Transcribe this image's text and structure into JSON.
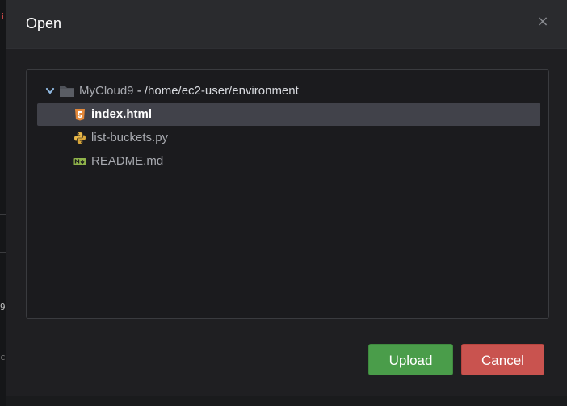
{
  "dialog": {
    "title": "Open",
    "close_label": "×"
  },
  "tree": {
    "root": {
      "name": "MyCloud9",
      "path": " - /home/ec2-user/environment",
      "expanded": true
    },
    "files": [
      {
        "label": "index.html",
        "icon": "html5-icon",
        "selected": true
      },
      {
        "label": "list-buckets.py",
        "icon": "python-icon",
        "selected": false
      },
      {
        "label": "README.md",
        "icon": "markdown-icon",
        "selected": false
      }
    ]
  },
  "buttons": {
    "upload_label": "Upload",
    "cancel_label": "Cancel"
  },
  "colors": {
    "upload": "#4a9d4a",
    "cancel": "#c9534f",
    "selected_row": "#41424a",
    "html_icon": "#e4893a",
    "python_icon": "#e8b84a",
    "markdown_icon": "#8fb34a"
  }
}
